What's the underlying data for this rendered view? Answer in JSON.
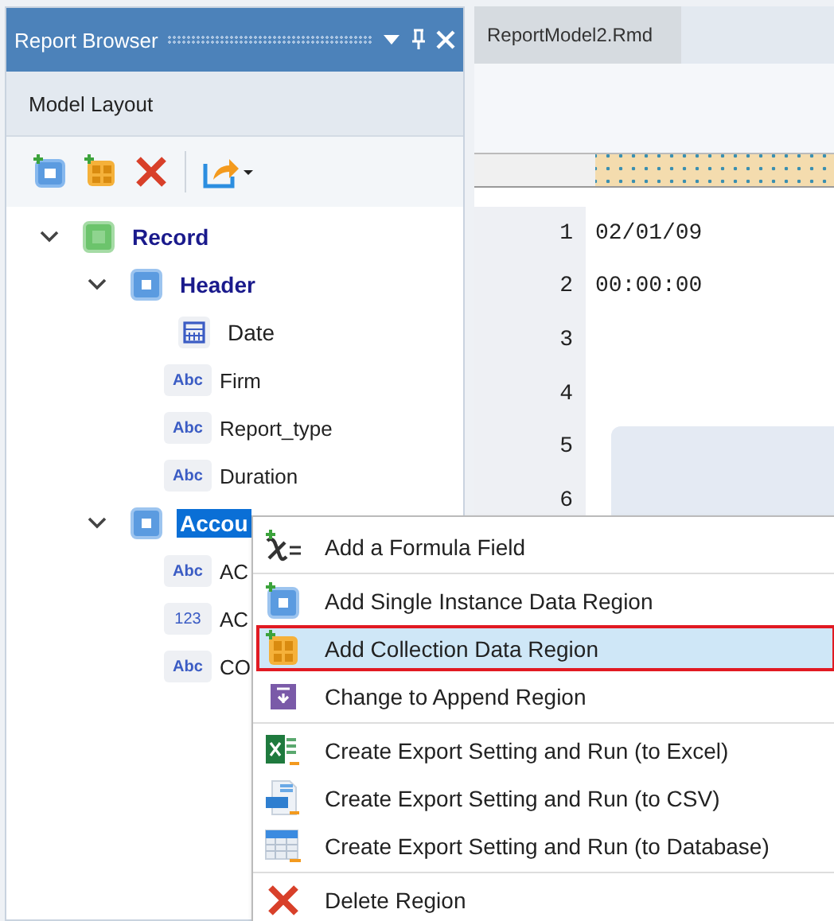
{
  "panel": {
    "title": "Report Browser",
    "section": "Model Layout"
  },
  "tree": [
    {
      "label": "Record",
      "kind": "record",
      "expanded": true,
      "selected": false,
      "children": [
        {
          "label": "Header",
          "kind": "region",
          "expanded": true,
          "selected": false,
          "children": [
            {
              "label": "Date",
              "kind": "date",
              "selected": false
            },
            {
              "label": "Firm",
              "kind": "text",
              "badge": "Abc",
              "selected": false
            },
            {
              "label": "Report_type",
              "kind": "text",
              "badge": "Abc",
              "selected": false
            },
            {
              "label": "Duration",
              "kind": "text",
              "badge": "Abc",
              "selected": false
            }
          ]
        },
        {
          "label": "Accou",
          "kind": "region",
          "expanded": true,
          "selected": true,
          "children": [
            {
              "label": "AC",
              "kind": "text",
              "badge": "Abc",
              "selected": false
            },
            {
              "label": "AC",
              "kind": "number",
              "badge": "123",
              "selected": false
            },
            {
              "label": "CO",
              "kind": "text",
              "badge": "Abc",
              "selected": false
            }
          ]
        }
      ]
    }
  ],
  "editor": {
    "tab": "ReportModel2.Rmd",
    "lines": [
      {
        "number": "1",
        "text": "02/01/09"
      },
      {
        "number": "2",
        "text": "00:00:00"
      },
      {
        "number": "3"
      },
      {
        "number": "4"
      },
      {
        "number": "5"
      },
      {
        "number": "6"
      }
    ]
  },
  "context_menu": [
    [
      {
        "label": "Add a Formula Field",
        "kind": "formula",
        "selected": false
      }
    ],
    [
      {
        "label": "Add Single Instance Data Region",
        "kind": "region",
        "selected": false
      },
      {
        "label": "Add Collection Data Region",
        "kind": "collection",
        "selected": true
      },
      {
        "label": "Change to Append Region",
        "kind": "append",
        "selected": false
      }
    ],
    [
      {
        "label": "Create Export Setting and Run (to Excel)",
        "kind": "excel",
        "selected": false
      },
      {
        "label": "Create Export Setting and Run (to CSV)",
        "kind": "csv",
        "selected": false
      },
      {
        "label": "Create Export Setting and Run (to Database)",
        "kind": "database",
        "selected": false
      }
    ],
    [
      {
        "label": "Delete Region",
        "kind": "delete",
        "selected": false
      }
    ]
  ]
}
